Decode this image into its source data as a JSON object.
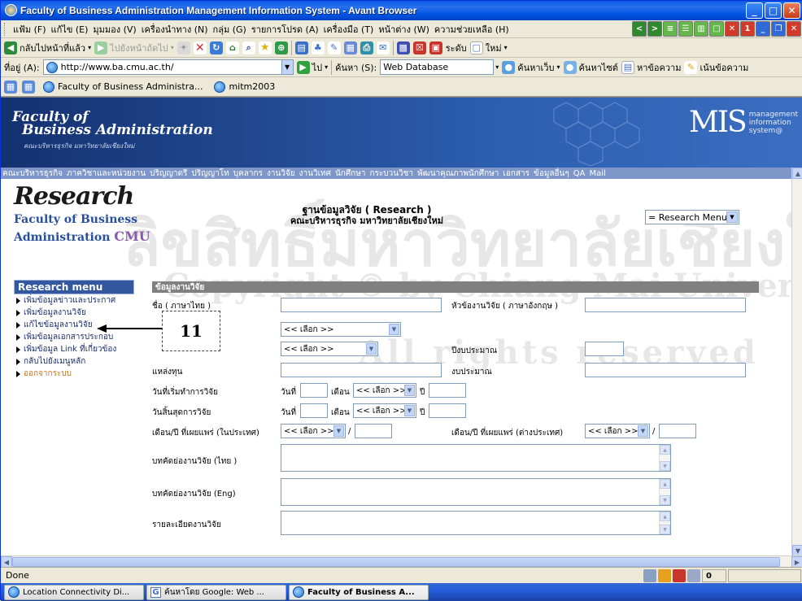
{
  "window": {
    "title": "Faculty of Business Administration Management Information System - Avant Browser"
  },
  "menubar": {
    "items": [
      "แฟ้ม (F)",
      "แก้ไข (E)",
      "มุมมอง (V)",
      "เครื่องนำทาง (N)",
      "กลุ่ม (G)",
      "รายการโปรด (A)",
      "เครื่องมือ (T)",
      "หน้าต่าง (W)",
      "ความช่วยเหลือ (H)"
    ]
  },
  "toolbar": {
    "back_label": "กลับไปหน้าที่แล้ว",
    "forward_label": "ไปยังหน้าถัดไป",
    "size_label": "ระดับ",
    "new_label": "ใหม่"
  },
  "addressbar": {
    "label": "ที่อยู่ (A):",
    "url": "http://www.ba.cmu.ac.th/",
    "go_label": "ไป",
    "search_label": "ค้นหา (S):",
    "search_value": "Web Database",
    "web_search": "ค้นหาเว็บ",
    "site_search": "ค้นหาไซต์",
    "find_text": "หาข้อความ",
    "highlight": "เน้นข้อความ"
  },
  "tabs": [
    {
      "label": "Faculty of Business Administra..."
    },
    {
      "label": "mitm2003"
    }
  ],
  "banner": {
    "line1": "Faculty of",
    "line2": "Business Administration",
    "line3": "คณะบริหารธุรกิจ มหาวิทยาลัยเชียงใหม่",
    "mis": "MIS",
    "mis_sub1": "management",
    "mis_sub2": "information",
    "mis_sub3": "system@"
  },
  "topnav": {
    "items": [
      "คณะบริหารธุรกิจ",
      "ภาควิชาและหน่วยงาน",
      "ปริญญาตรี",
      "ปริญญาโท",
      "บุคลากร",
      "งานวิจัย",
      "งานวิเทศ",
      "นักศึกษา",
      "กระบวนวิชา",
      "พัฒนาคุณภาพนักศึกษา",
      "เอกสาร",
      "ข้อมูลอื่นๆ",
      "QA",
      "Mail"
    ]
  },
  "research_logo": {
    "word": "Research",
    "line1": "Faculty of Business",
    "line2": "Administration",
    "cmu": "CMU"
  },
  "heading": {
    "line1": "ฐานข้อมูลวิจัย ( Research )",
    "line2": "คณะบริหารธุรกิจ มหาวิทยาลัยเชียงใหม่"
  },
  "research_menu_select": "= Research Menu =",
  "sidebar": {
    "title": "Research menu",
    "items": [
      {
        "label": "เพิ่มข้อมูลข่าวและประกาศ"
      },
      {
        "label": "เพิ่มข้อมูลงานวิจัย"
      },
      {
        "label": "แก้ไขข้อมูลงานวิจัย"
      },
      {
        "label": "เพิ่มข้อมูลเอกสารประกอบ"
      },
      {
        "label": "เพิ่มข้อมูล Link ที่เกี่ยวข้อง"
      },
      {
        "label": "กลับไปยังเมนูหลัก"
      },
      {
        "label": "ออกจากระบบ"
      }
    ]
  },
  "form": {
    "header": "ข้อมูลงานวิจัย",
    "title_th_label": "ชื่อ  ( ภาษาไทย )",
    "title_en_label": "หัวข้องานวิจัย ( ภาษาอังกฤษ )",
    "select_placeholder": "<< เลือก >>",
    "budget_year_label": "ปีงบประมาณ",
    "fund_source_label": "แหล่งทุน",
    "budget_label": "งบประมาณ",
    "start_date_label": "วันที่เริ่มทำการวิจัย",
    "end_date_label": "วันสิ้นสุดการวิจัย",
    "day_label": "วันที่",
    "month_label": "เดือน",
    "year_label": "ปี",
    "pub_domestic_label": "เดือน/ปี ที่เผยแพร่ (ในประเทศ)",
    "pub_foreign_label": "เดือน/ปี ที่เผยแพร่ (ต่างประเทศ)",
    "slash": "/",
    "abstract_th_label": "บทคัดย่องานวิจัย (ไทย )",
    "abstract_en_label": "บทคัดย่องานวิจัย (Eng)",
    "details_label": "รายละเอียดงานวิจัย"
  },
  "callout": {
    "number": "11"
  },
  "watermark": {
    "line1": "ลิขสิทธิ์มหาวิทยาลัยเชียงใหม่",
    "line2": "Copyright © by Chiang Mai University",
    "line3": "All rights reserved"
  },
  "statusbar": {
    "text": "Done",
    "count": "0"
  },
  "taskbar": [
    {
      "label": "Location Connectivity Di..."
    },
    {
      "label": "ค้นหาโดย Google: Web ..."
    },
    {
      "label": "Faculty of Business A..."
    }
  ]
}
